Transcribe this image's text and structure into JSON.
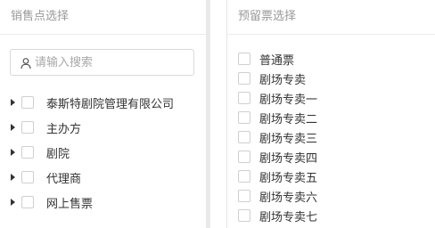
{
  "left_panel": {
    "title": "销售点选择",
    "search": {
      "placeholder": "请输入搜索",
      "icon": "user-icon"
    },
    "tree": [
      {
        "label": "泰斯特剧院管理有限公司"
      },
      {
        "label": "主办方"
      },
      {
        "label": "剧院"
      },
      {
        "label": "代理商"
      },
      {
        "label": "网上售票"
      }
    ]
  },
  "right_panel": {
    "title": "预留票选择",
    "tickets": [
      {
        "label": "普通票"
      },
      {
        "label": "剧场专卖"
      },
      {
        "label": "剧场专卖一"
      },
      {
        "label": "剧场专卖二"
      },
      {
        "label": "剧场专卖三"
      },
      {
        "label": "剧场专卖四"
      },
      {
        "label": "剧场专卖五"
      },
      {
        "label": "剧场专卖六"
      },
      {
        "label": "剧场专卖七"
      }
    ]
  }
}
